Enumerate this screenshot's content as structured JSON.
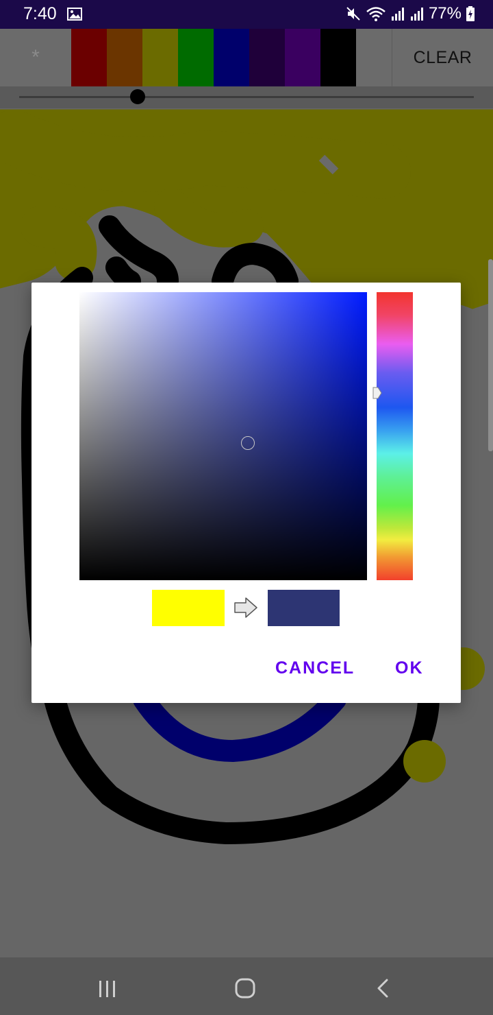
{
  "status_bar": {
    "time": "7:40",
    "battery": "77%",
    "icons": [
      "image-icon",
      "mute-icon",
      "wifi-icon",
      "signal-icon",
      "signal-icon",
      "battery-charging-icon"
    ]
  },
  "toolbar": {
    "eraser_label": "*",
    "swatches": [
      "#6b0000",
      "#6b3500",
      "#6b6b00",
      "#006b00",
      "#00006b",
      "#1f003a",
      "#3a0060",
      "#000000"
    ],
    "clear_label": "CLEAR"
  },
  "brush_size": {
    "fraction": 0.26
  },
  "color_picker": {
    "current_hue_color": "#001bff",
    "old_color": "#ffff00",
    "new_color": "#2d3573",
    "cancel_label": "CANCEL",
    "ok_label": "OK"
  },
  "nav_bar": {
    "icons": [
      "recents-icon",
      "home-icon",
      "back-icon"
    ]
  }
}
